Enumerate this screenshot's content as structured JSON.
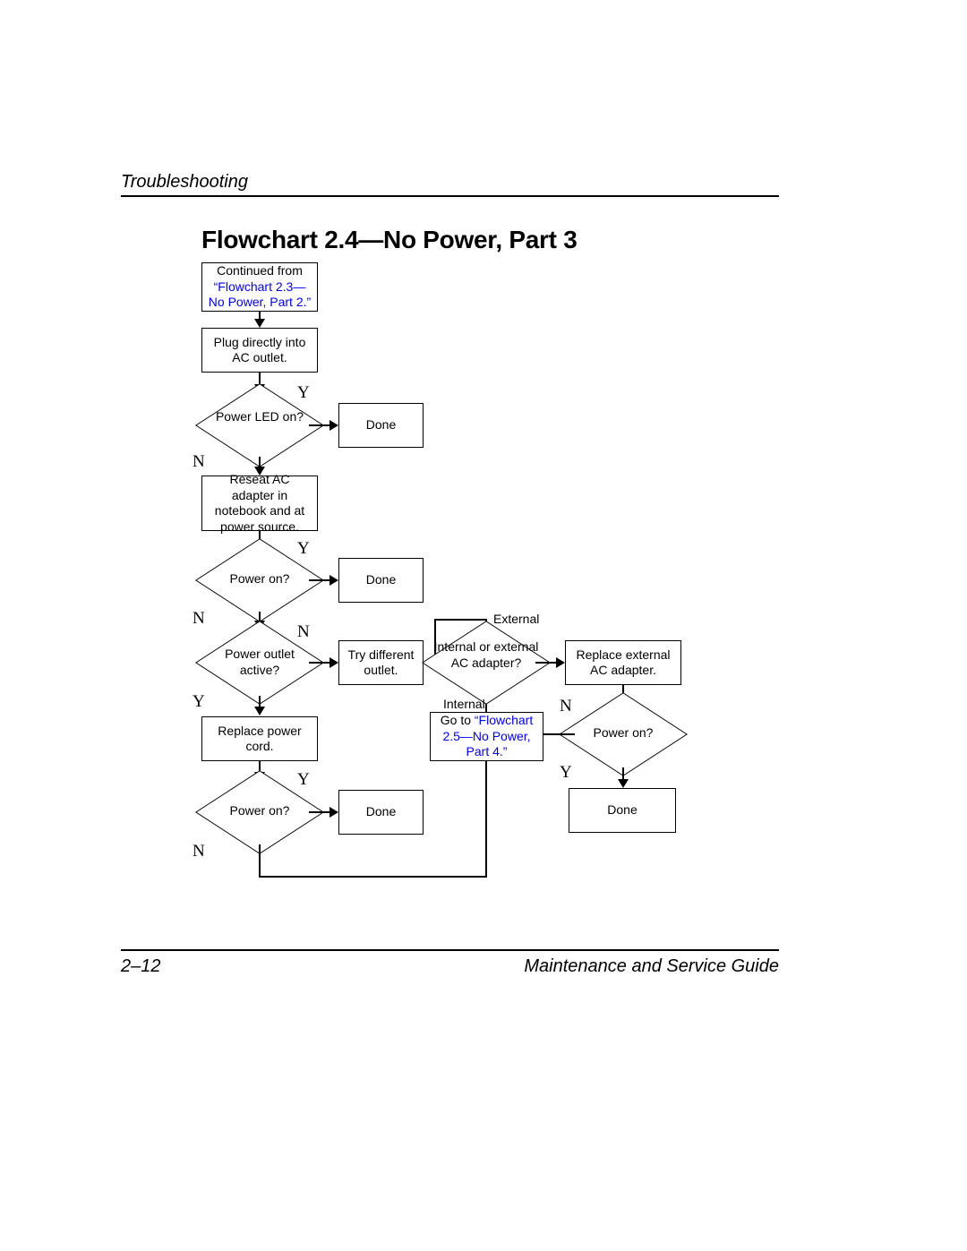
{
  "header": {
    "section": "Troubleshooting"
  },
  "title": "Flowchart 2.4—No Power, Part 3",
  "footer": {
    "left": "2–12",
    "right": "Maintenance and Service Guide"
  },
  "labels": {
    "Y": "Y",
    "N": "N",
    "external": "External",
    "internal": "Internal"
  },
  "nodes": {
    "start_pre": "Continued from ",
    "start_link": "“Flowchart 2.3—No Power, Part 2.”",
    "plug": "Plug directly into AC outlet.",
    "led": "Power LED on?",
    "done1": "Done",
    "reseat": "Reseat AC adapter in notebook and at power source.",
    "poweron1": "Power on?",
    "done2": "Done",
    "outlet": "Power outlet active?",
    "tryoutlet": "Try different outlet.",
    "replacecord": "Replace power cord.",
    "poweron2": "Power on?",
    "done3": "Done",
    "adapter": "Internal or external AC adapter?",
    "replaceext": "Replace external AC adapter.",
    "goto_pre": "Go to ",
    "goto_link": "“Flowchart 2.5—No Power, Part 4.”",
    "poweron3": "Power on?",
    "done4": "Done"
  },
  "chart_data": {
    "type": "flowchart",
    "title": "Flowchart 2.4 — No Power, Part 3",
    "nodes": [
      {
        "id": "start",
        "type": "terminator",
        "text": "Continued from \"Flowchart 2.3—No Power, Part 2.\"",
        "link": "Flowchart 2.3"
      },
      {
        "id": "plug",
        "type": "process",
        "text": "Plug directly into AC outlet."
      },
      {
        "id": "led",
        "type": "decision",
        "text": "Power LED on?"
      },
      {
        "id": "done1",
        "type": "terminator",
        "text": "Done"
      },
      {
        "id": "reseat",
        "type": "process",
        "text": "Reseat AC adapter in notebook and at power source."
      },
      {
        "id": "poweron1",
        "type": "decision",
        "text": "Power on?"
      },
      {
        "id": "done2",
        "type": "terminator",
        "text": "Done"
      },
      {
        "id": "outlet",
        "type": "decision",
        "text": "Power outlet active?"
      },
      {
        "id": "tryoutlet",
        "type": "process",
        "text": "Try different outlet."
      },
      {
        "id": "replacecord",
        "type": "process",
        "text": "Replace power cord."
      },
      {
        "id": "poweron2",
        "type": "decision",
        "text": "Power on?"
      },
      {
        "id": "done3",
        "type": "terminator",
        "text": "Done"
      },
      {
        "id": "adapter",
        "type": "decision",
        "text": "Internal or external AC adapter?"
      },
      {
        "id": "replaceext",
        "type": "process",
        "text": "Replace external AC adapter."
      },
      {
        "id": "goto",
        "type": "terminator",
        "text": "Go to \"Flowchart 2.5—No Power, Part 4.\"",
        "link": "Flowchart 2.5"
      },
      {
        "id": "poweron3",
        "type": "decision",
        "text": "Power on?"
      },
      {
        "id": "done4",
        "type": "terminator",
        "text": "Done"
      }
    ],
    "edges": [
      {
        "from": "start",
        "to": "plug"
      },
      {
        "from": "plug",
        "to": "led"
      },
      {
        "from": "led",
        "to": "done1",
        "label": "Y"
      },
      {
        "from": "led",
        "to": "reseat",
        "label": "N"
      },
      {
        "from": "reseat",
        "to": "poweron1"
      },
      {
        "from": "poweron1",
        "to": "done2",
        "label": "Y"
      },
      {
        "from": "poweron1",
        "to": "outlet",
        "label": "N"
      },
      {
        "from": "outlet",
        "to": "tryoutlet",
        "label": "N"
      },
      {
        "from": "outlet",
        "to": "replacecord",
        "label": "Y"
      },
      {
        "from": "tryoutlet",
        "to": "adapter"
      },
      {
        "from": "replacecord",
        "to": "poweron2"
      },
      {
        "from": "poweron2",
        "to": "done3",
        "label": "Y"
      },
      {
        "from": "poweron2",
        "to": "adapter",
        "label": "N"
      },
      {
        "from": "adapter",
        "to": "replaceext",
        "label": "External"
      },
      {
        "from": "adapter",
        "to": "goto",
        "label": "Internal"
      },
      {
        "from": "replaceext",
        "to": "poweron3"
      },
      {
        "from": "poweron3",
        "to": "goto",
        "label": "N"
      },
      {
        "from": "poweron3",
        "to": "done4",
        "label": "Y"
      }
    ]
  }
}
